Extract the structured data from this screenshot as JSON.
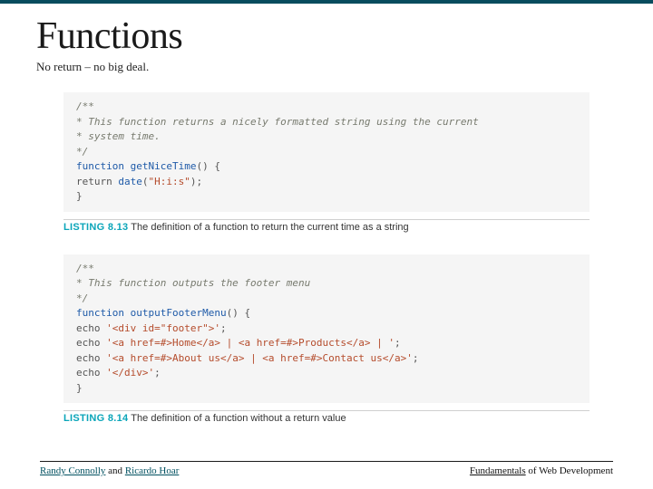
{
  "title": "Functions",
  "subtitle": "No return – no big deal.",
  "codeA": {
    "c1": "/**",
    "c2": " * This function returns a nicely formatted string using the current",
    "c3": " * system time.",
    "c4": " */",
    "kw": "function",
    "fn": "getNiceTime",
    "paren": "() {",
    "ret": "    return ",
    "dfn": "date",
    "dparen": "(",
    "dstr": "\"H:i:s\"",
    "dclose": ");",
    "close": "}"
  },
  "captionA": {
    "label": "LISTING 8.13",
    "text": " The definition of a function to return the current time as a string"
  },
  "codeB": {
    "c1": "/**",
    "c2": " * This function outputs the footer menu",
    "c3": " */",
    "kw": "function",
    "fn": "outputFooterMenu",
    "paren": "() {",
    "e1a": "    echo ",
    "e1s": "'<div id=\"footer\">'",
    "e1z": ";",
    "e2a": "    echo ",
    "e2s": "'<a href=#>Home</a> | <a href=#>Products</a> | '",
    "e2z": ";",
    "e3a": "    echo ",
    "e3s": "'<a href=#>About us</a> | <a href=#>Contact us</a>'",
    "e3z": ";",
    "e4a": "    echo ",
    "e4s": "'</div>'",
    "e4z": ";",
    "close": "}"
  },
  "captionB": {
    "label": "LISTING 8.14",
    "text": " The definition of a function without a return value"
  },
  "footer": {
    "left1": "Randy Connolly",
    "leftAnd": " and ",
    "left2": "Ricardo Hoar",
    "right1": "Fundamentals",
    "rightRest": " of Web Development"
  }
}
